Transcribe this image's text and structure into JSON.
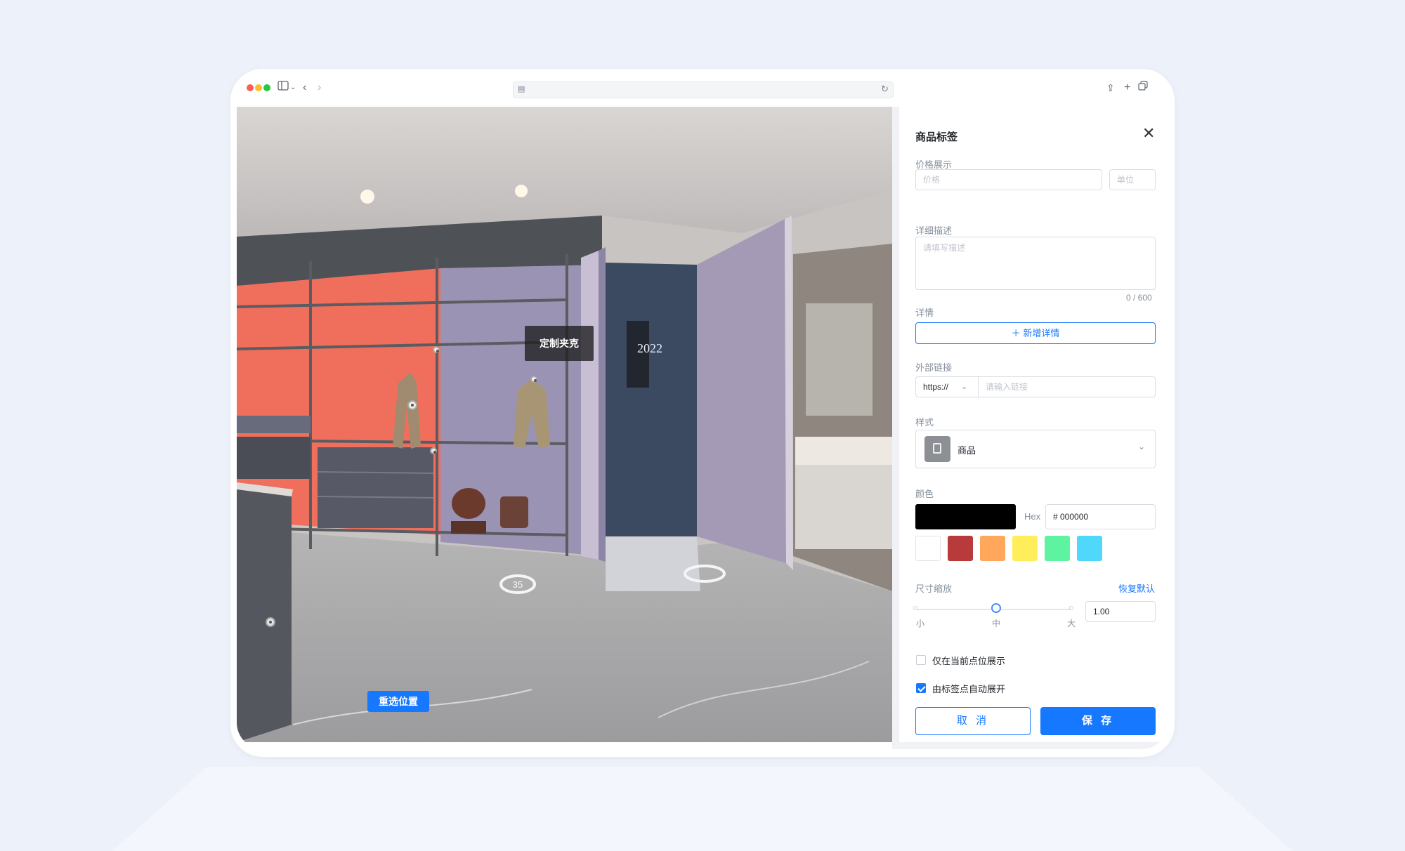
{
  "browser": {
    "address": "",
    "icons": [
      "sidebar-icon",
      "chevron-down-icon",
      "back-icon",
      "forward-icon",
      "page-icon",
      "reload-icon",
      "share-icon",
      "new-tab-icon",
      "tabs-icon"
    ]
  },
  "pano": {
    "tag_label": "定制夹克",
    "reselect_label": "重选位置",
    "floor_badge": "35",
    "sign_text": "2022"
  },
  "panel": {
    "title": "商品标签",
    "price": {
      "label": "价格展示",
      "price_placeholder": "价格",
      "unit_placeholder": "单位"
    },
    "description": {
      "label": "详细描述",
      "placeholder": "请填写描述",
      "counter": "0 / 600"
    },
    "detail": {
      "label": "详情",
      "add_button": "新增详情"
    },
    "link": {
      "label": "外部链接",
      "protocol": "https://",
      "placeholder": "请输入链接"
    },
    "style": {
      "label": "样式",
      "selected": "商品"
    },
    "color": {
      "label": "颜色",
      "current": "#000000",
      "hex_label": "Hex",
      "hex_value": "# 000000",
      "presets": [
        "#ffffff",
        "#b93a3a",
        "#ffa75a",
        "#ffee5c",
        "#5ef3a0",
        "#4fd8fc"
      ]
    },
    "size": {
      "label": "尺寸缩放",
      "reset": "恢复默认",
      "min_label": "小",
      "mid_label": "中",
      "max_label": "大",
      "value": "1.00",
      "slider_level": 0.5
    },
    "options": [
      {
        "label": "仅在当前点位展示",
        "checked": false
      },
      {
        "label": "由标签点自动展开",
        "checked": true
      }
    ],
    "cancel": "取 消",
    "save": "保 存"
  }
}
